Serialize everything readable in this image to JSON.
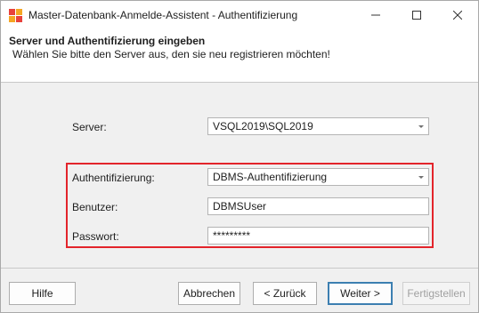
{
  "window": {
    "title": "Master-Datenbank-Anmelde-Assistent - Authentifizierung"
  },
  "header": {
    "title": "Server und Authentifizierung eingeben",
    "subtitle": "Wählen Sie bitte den Server aus, den sie neu registrieren möchten!"
  },
  "form": {
    "server_label": "Server:",
    "server_value": "VSQL2019\\SQL2019",
    "auth_label": "Authentifizierung:",
    "auth_value": "DBMS-Authentifizierung",
    "user_label": "Benutzer:",
    "user_value": "DBMSUser",
    "password_label": "Passwort:",
    "password_value": "*********"
  },
  "buttons": {
    "help": "Hilfe",
    "cancel": "Abbrechen",
    "back": "< Zurück",
    "next": "Weiter >",
    "finish": "Fertigstellen"
  },
  "icons": {
    "app": "app-icon",
    "minimize": "minimize-icon",
    "maximize": "maximize-icon",
    "close": "close-icon"
  },
  "colors": {
    "highlight_border": "#e3242b",
    "default_button_border": "#3c7fb1"
  }
}
